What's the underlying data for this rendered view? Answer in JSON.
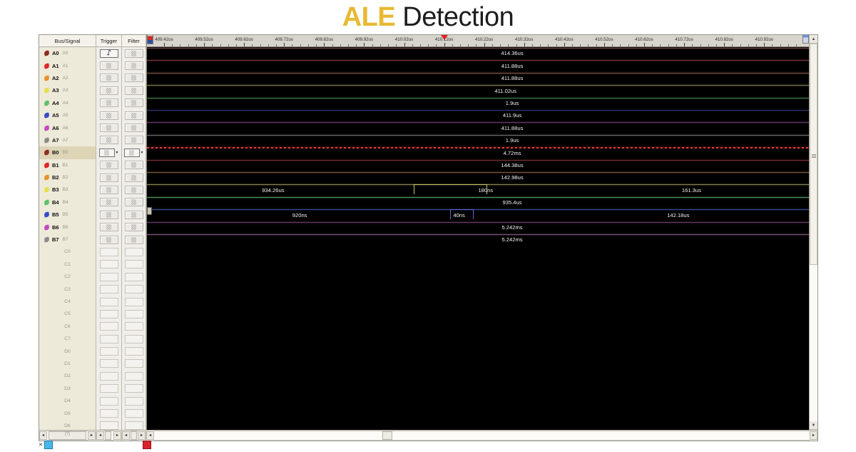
{
  "title": {
    "accent": "ALE",
    "rest": " Detection",
    "accent_color": "#e8b931",
    "rest_color": "#1d1d1d"
  },
  "columns": {
    "signal": "Bus/Signal",
    "trigger": "Trigger",
    "filter": "Filter"
  },
  "signals": [
    {
      "name": "A0",
      "alias": "A0",
      "color": "#8a2f22",
      "trigger": "rising-edge",
      "filter": "hatch",
      "wave_color": "#6b4a4a",
      "label": "414.36us"
    },
    {
      "name": "A1",
      "alias": "A1",
      "color": "#e02626",
      "trigger": "hatch",
      "filter": "hatch",
      "wave_color": "#7a3a42",
      "label": "411.88us"
    },
    {
      "name": "A2",
      "alias": "A2",
      "color": "#e8912a",
      "trigger": "hatch",
      "filter": "hatch",
      "wave_color": "#7d5444",
      "label": "411.88us"
    },
    {
      "name": "A3",
      "alias": "A3",
      "color": "#e8de4a",
      "trigger": "hatch",
      "filter": "hatch",
      "wave_color": "#7e7a52",
      "label": "411.02us"
    },
    {
      "name": "A4",
      "alias": "A4",
      "color": "#5fc16a",
      "trigger": "hatch",
      "filter": "hatch",
      "wave_color": "#3f7a4c",
      "label": "1.9us"
    },
    {
      "name": "A5",
      "alias": "A5",
      "color": "#3a49c4",
      "trigger": "hatch",
      "filter": "hatch",
      "wave_color": "#2f3570",
      "label": "411.9us"
    },
    {
      "name": "A6",
      "alias": "A6",
      "color": "#c44ac0",
      "trigger": "hatch",
      "filter": "hatch",
      "wave_color": "#6e3a6c",
      "label": "411.88us"
    },
    {
      "name": "A7",
      "alias": "A7",
      "color": "#8c8c8c",
      "trigger": "hatch",
      "filter": "hatch",
      "wave_color": "#6d6d6d",
      "label": "1.9us"
    },
    {
      "name": "B0",
      "alias": "B0",
      "color": "#8a2f22",
      "trigger": "hatch-dropdown",
      "filter": "hatch-dropdown",
      "wave_color": "#e03b3b",
      "label": "4.72ms",
      "selected": true,
      "dashed": true
    },
    {
      "name": "B1",
      "alias": "B1",
      "color": "#e02626",
      "trigger": "hatch",
      "filter": "hatch",
      "wave_color": "#7a3038",
      "label": "144.38us"
    },
    {
      "name": "B2",
      "alias": "B2",
      "color": "#e8912a",
      "trigger": "hatch",
      "filter": "hatch",
      "wave_color": "#7b5a38",
      "label": "142.98us"
    },
    {
      "name": "B3",
      "alias": "B3",
      "color": "#e8de4a",
      "trigger": "hatch",
      "filter": "hatch",
      "wave_color": "#8a8356",
      "label": "934.26us"
    },
    {
      "name": "B4",
      "alias": "B4",
      "color": "#5fc16a",
      "trigger": "hatch",
      "filter": "hatch",
      "wave_color": "#4d9a60",
      "label": "935.4us"
    },
    {
      "name": "B5",
      "alias": "B5",
      "color": "#3a49c4",
      "trigger": "hatch",
      "filter": "hatch",
      "wave_color": "#394a95",
      "label": "920ns"
    },
    {
      "name": "B6",
      "alias": "B6",
      "color": "#c44ac0",
      "trigger": "hatch",
      "filter": "hatch",
      "wave_color": "#6b3a68",
      "label": "5.242ms"
    },
    {
      "name": "B7",
      "alias": "B7",
      "color": "#8c8c8c",
      "trigger": "hatch",
      "filter": "hatch",
      "wave_color": "#7a5a7c",
      "label": "5.242ms"
    },
    {
      "name": "C0",
      "alias": "",
      "empty": true
    },
    {
      "name": "C1",
      "alias": "",
      "empty": true
    },
    {
      "name": "C2",
      "alias": "",
      "empty": true
    },
    {
      "name": "C3",
      "alias": "",
      "empty": true
    },
    {
      "name": "C4",
      "alias": "",
      "empty": true
    },
    {
      "name": "C5",
      "alias": "",
      "empty": true
    },
    {
      "name": "C6",
      "alias": "",
      "empty": true
    },
    {
      "name": "C7",
      "alias": "",
      "empty": true
    },
    {
      "name": "D0",
      "alias": "",
      "empty": true
    },
    {
      "name": "D1",
      "alias": "",
      "empty": true
    },
    {
      "name": "D2",
      "alias": "",
      "empty": true
    },
    {
      "name": "D3",
      "alias": "",
      "empty": true
    },
    {
      "name": "D4",
      "alias": "",
      "empty": true
    },
    {
      "name": "D5",
      "alias": "",
      "empty": true
    },
    {
      "name": "D6",
      "alias": "",
      "empty": true
    }
  ],
  "timeline": {
    "ticks": [
      "409.42us",
      "409.52us",
      "409.62us",
      "409.72us",
      "409.82us",
      "409.92us",
      "410.02us",
      "410.12us",
      "410.22us",
      "410.32us",
      "410.42us",
      "410.52us",
      "410.62us",
      "410.72us",
      "410.82us",
      "410.92us"
    ],
    "cursor_tick": "410.12us",
    "cursor_color": "#e02222"
  },
  "measurements": [
    {
      "row": "A0",
      "value": "414.36us",
      "x_pct": 55
    },
    {
      "row": "A1",
      "value": "411.88us",
      "x_pct": 55
    },
    {
      "row": "A2",
      "value": "411.88us",
      "x_pct": 55
    },
    {
      "row": "A3",
      "value": "411.02us",
      "x_pct": 54
    },
    {
      "row": "A4",
      "value": "1.9us",
      "x_pct": 55
    },
    {
      "row": "A5",
      "value": "411.9us",
      "x_pct": 55
    },
    {
      "row": "A6",
      "value": "411.88us",
      "x_pct": 55
    },
    {
      "row": "A7",
      "value": "1.9us",
      "x_pct": 55
    },
    {
      "row": "B0",
      "value": "4.72ms",
      "x_pct": 55
    },
    {
      "row": "B1",
      "value": "144.38us",
      "x_pct": 55
    },
    {
      "row": "B2",
      "value": "142.98us",
      "x_pct": 55
    },
    {
      "row": "B3a",
      "value": "934.26us",
      "x_pct": 19
    },
    {
      "row": "B3b",
      "value": "180ns",
      "x_pct": 51
    },
    {
      "row": "B3c",
      "value": "161.3us",
      "x_pct": 82
    },
    {
      "row": "B4",
      "value": "935.4us",
      "x_pct": 55
    },
    {
      "row": "B5a",
      "value": "920ns",
      "x_pct": 23
    },
    {
      "row": "B5b",
      "value": "40ns",
      "x_pct": 47
    },
    {
      "row": "B5c",
      "value": "142.18us",
      "x_pct": 80
    },
    {
      "row": "B6",
      "value": "5.242ms",
      "x_pct": 55
    },
    {
      "row": "B7",
      "value": "5.242ms",
      "x_pct": 55
    }
  ],
  "scrollbars": {
    "signal_label": "[?]",
    "left_arrow": "◄",
    "right_arrow": "►",
    "up_arrow": "▲",
    "down_arrow": "▼"
  }
}
